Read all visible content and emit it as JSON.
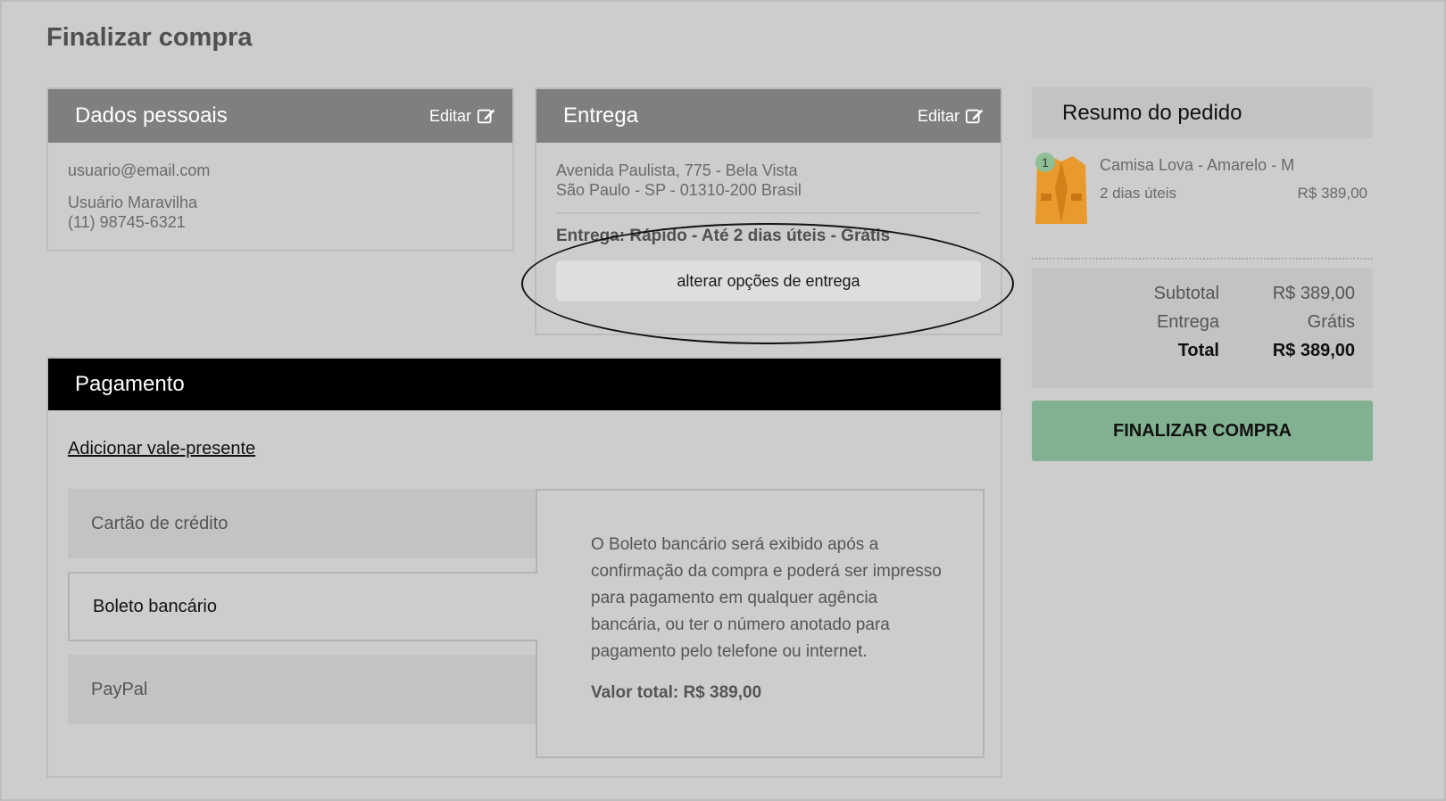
{
  "page": {
    "title": "Finalizar compra"
  },
  "personal": {
    "title": "Dados pessoais",
    "edit_label": "Editar",
    "email": "usuario@email.com",
    "name": "Usuário Maravilha",
    "phone": "(11) 98745-6321"
  },
  "delivery": {
    "title": "Entrega",
    "edit_label": "Editar",
    "address_line1": "Avenida Paulista, 775 - Bela Vista",
    "address_line2": "São Paulo - SP - 01310-200 Brasil",
    "option": "Entrega: Rápido - Até 2 dias úteis - Grátis",
    "change_button": "alterar opções de entrega"
  },
  "payment": {
    "title": "Pagamento",
    "gift_link": "Adicionar vale-presente",
    "methods": [
      "Cartão de crédito",
      "Boleto bancário",
      "PayPal"
    ],
    "selected_method": "Boleto bancário",
    "description": "O Boleto bancário será exibido após a confirmação da compra e poderá ser impresso para pagamento em qualquer agência bancária, ou ter o número anotado para pagamento pelo telefone ou internet.",
    "total_text": "Valor total: R$ 389,00"
  },
  "summary": {
    "title": "Resumo do pedido",
    "item": {
      "quantity": "1",
      "name": "Camisa Lova - Amarelo - M",
      "eta": "2 dias úteis",
      "price": "R$ 389,00"
    },
    "subtotal_label": "Subtotal",
    "subtotal_value": "R$ 389,00",
    "shipping_label": "Entrega",
    "shipping_value": "Grátis",
    "total_label": "Total",
    "total_value": "R$ 389,00",
    "finish_button": "FINALIZAR COMPRA"
  },
  "colors": {
    "background": "#cdcdcd",
    "card_header": "#7f7f7f",
    "payment_header": "#000000",
    "finish_button": "#82b192",
    "badge": "#8fbf95"
  }
}
